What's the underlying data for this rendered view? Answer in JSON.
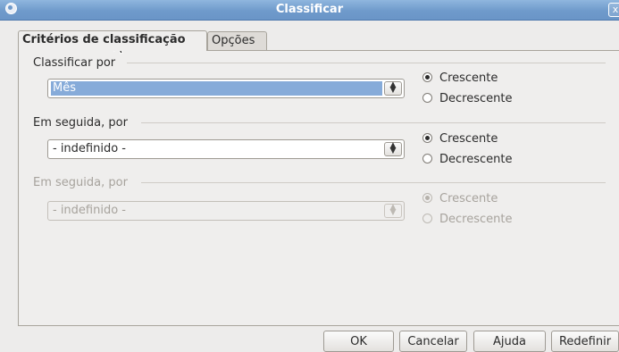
{
  "window": {
    "title": "Classificar",
    "close_glyph": "x",
    "colors": {
      "titlebar": "#6f9acb",
      "selection": "#86abd9"
    }
  },
  "tabs": [
    {
      "label": "Critérios de classificação",
      "active": true
    },
    {
      "label": "Opções",
      "active": false
    }
  ],
  "groups": [
    {
      "label": "Classificar por",
      "enabled": true,
      "combo_value": "Mês",
      "combo_selected": true,
      "radios": [
        {
          "label": "Crescente",
          "checked": true
        },
        {
          "label": "Decrescente",
          "checked": false
        }
      ]
    },
    {
      "label": "Em seguida, por",
      "enabled": true,
      "combo_value": "- indefinido -",
      "combo_selected": false,
      "radios": [
        {
          "label": "Crescente",
          "checked": true
        },
        {
          "label": "Decrescente",
          "checked": false
        }
      ]
    },
    {
      "label": "Em seguida, por",
      "enabled": false,
      "combo_value": "- indefinido -",
      "combo_selected": false,
      "radios": [
        {
          "label": "Crescente",
          "checked": true
        },
        {
          "label": "Decrescente",
          "checked": false
        }
      ]
    }
  ],
  "buttons": {
    "ok": "OK",
    "cancel": "Cancelar",
    "help": "Ajuda",
    "reset": "Redefinir"
  },
  "icons": {
    "combo_arrows": "updown-arrows-icon",
    "window_menu": "window-menu-icon",
    "cursor": "mouse-pointer-icon"
  }
}
